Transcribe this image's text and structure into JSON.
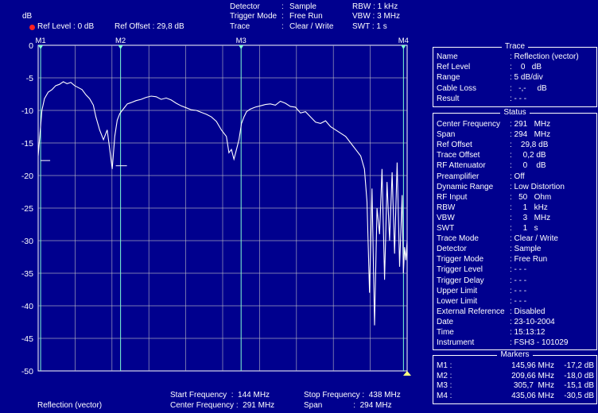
{
  "header": {
    "detector_label": "Detector",
    "detector_sep": ":",
    "detector_value": "Sample",
    "trigger_label": "Trigger Mode",
    "trigger_sep": ":",
    "trigger_value": "Free Run",
    "trace_label": "Trace",
    "trace_sep": ":",
    "trace_value": "Clear / Write",
    "rbw": "RBW : 1 kHz",
    "vbw": "VBW : 3 MHz",
    "swt": "SWT : 1 s",
    "unit": "dB",
    "ref_level": "Ref Level : 0 dB",
    "ref_offset": "Ref Offset : 29,8 dB"
  },
  "colors": {
    "background": "#00008e",
    "grid": "#c8c8c8",
    "trace": "#ffffff",
    "marker_line": "#7fffd4",
    "ref_dot": "#ff2020",
    "end_marker": "#ffff80"
  },
  "chart_data": {
    "type": "line",
    "ylim": [
      -50,
      0
    ],
    "yticks": [
      "0",
      "-5",
      "-10",
      "-15",
      "-20",
      "-25",
      "-30",
      "-35",
      "-40",
      "-45",
      "-50"
    ],
    "xlim": [
      144,
      438
    ],
    "x_unit": "MHz",
    "y_unit": "dB",
    "grid": true,
    "markers": [
      {
        "label": "M1",
        "x": 145.96,
        "y": -17.2
      },
      {
        "label": "M2",
        "x": 209.66,
        "y": -18.0
      },
      {
        "label": "M3",
        "x": 305.7,
        "y": -15.1
      },
      {
        "label": "M4",
        "x": 435.06,
        "y": -30.5
      }
    ],
    "series": [
      {
        "x": [
          144,
          147,
          149,
          152,
          155,
          158,
          161,
          164,
          167,
          170,
          173,
          176,
          179,
          182,
          185,
          188,
          190,
          193,
          196,
          199,
          201,
          203,
          205,
          207,
          209,
          211,
          213,
          215,
          218,
          222,
          226,
          230,
          234,
          238,
          242,
          246,
          250,
          254,
          258,
          262,
          266,
          270,
          274,
          278,
          282,
          286,
          290,
          294,
          296,
          298,
          300,
          302,
          304,
          306,
          308,
          310,
          313,
          317,
          321,
          325,
          329,
          333,
          337,
          341,
          345,
          349,
          353,
          357,
          361,
          365,
          369,
          373,
          377,
          381,
          385,
          389,
          393,
          397,
          401,
          404,
          406,
          408,
          410,
          412,
          414,
          416,
          418,
          420,
          422,
          424,
          426,
          428,
          430,
          432,
          434,
          435,
          436,
          437,
          438
        ],
        "y": [
          -17,
          -10,
          -8.2,
          -7.2,
          -6.8,
          -6.2,
          -6.0,
          -5.6,
          -5.9,
          -5.7,
          -6.2,
          -6.5,
          -6.8,
          -7.6,
          -8.2,
          -9.2,
          -11,
          -13,
          -14.5,
          -13,
          -16,
          -19,
          -14,
          -11.5,
          -10.5,
          -10,
          -9.5,
          -9,
          -8.8,
          -8.5,
          -8.3,
          -8.0,
          -7.8,
          -7.9,
          -8.3,
          -8.1,
          -8.4,
          -8.9,
          -9.3,
          -9.6,
          -9.9,
          -10,
          -10.3,
          -10.6,
          -11,
          -11.7,
          -13,
          -14,
          -16.5,
          -16,
          -17.5,
          -16,
          -14.5,
          -12,
          -11,
          -10.2,
          -9.8,
          -9.5,
          -9.3,
          -9.1,
          -9.0,
          -9.2,
          -8.6,
          -8.9,
          -9.4,
          -9.5,
          -10.4,
          -10.2,
          -11,
          -11.8,
          -12,
          -11.6,
          -12.5,
          -13,
          -13.5,
          -14,
          -15,
          -16,
          -17,
          -19,
          -24,
          -38,
          -22,
          -43,
          -25,
          -29,
          -19,
          -36,
          -21,
          -30,
          -19.5,
          -32,
          -18,
          -34,
          -23,
          -35,
          -31,
          -33,
          -30
        ]
      }
    ]
  },
  "footer": {
    "trace_name": "Reflection (vector)",
    "start_freq": "Start Frequency  :  144 MHz",
    "center_freq": "Center Frequency :  291 MHz",
    "stop_freq": "Stop Frequency :  438 MHz",
    "span": "Span              :  294 MHz"
  },
  "trace_panel": {
    "title": "Trace",
    "rows": [
      {
        "k": "Name",
        "v": ": Reflection (vector)"
      },
      {
        "k": "Ref Level",
        "v": ":    0   dB"
      },
      {
        "k": "Range",
        "v": ": 5 dB/div"
      },
      {
        "k": "Cable Loss",
        "v": ":   -,-     dB"
      },
      {
        "k": "Result",
        "v": ": - - -"
      }
    ]
  },
  "status_panel": {
    "title": "Status",
    "rows": [
      {
        "k": "Center Frequency",
        "v": ": 291   MHz"
      },
      {
        "k": "Span",
        "v": ": 294   MHz"
      },
      {
        "k": "Ref Offset",
        "v": ":    29,8 dB"
      },
      {
        "k": "Trace Offset",
        "v": ":     0,2 dB"
      },
      {
        "k": "RF Attenuator",
        "v": ":     0    dB"
      },
      {
        "k": "Preamplifier",
        "v": ": Off"
      },
      {
        "k": "Dynamic Range",
        "v": ": Low Distortion"
      },
      {
        "k": "RF Input",
        "v": ":   50   Ohm"
      },
      {
        "k": "RBW",
        "v": ":     1   kHz"
      },
      {
        "k": "VBW",
        "v": ":     3   MHz"
      },
      {
        "k": "SWT",
        "v": ":     1   s"
      },
      {
        "k": "Trace Mode",
        "v": ": Clear / Write"
      },
      {
        "k": "Detector",
        "v": ": Sample"
      },
      {
        "k": "Trigger Mode",
        "v": ": Free Run"
      },
      {
        "k": "Trigger Level",
        "v": ": - - -"
      },
      {
        "k": "Trigger Delay",
        "v": ": - - -"
      },
      {
        "k": "Upper Limit",
        "v": ": - - -"
      },
      {
        "k": "Lower Limit",
        "v": ": - - -"
      },
      {
        "k": "External Reference",
        "v": ": Disabled"
      },
      {
        "k": "Date",
        "v": ": 23-10-2004"
      },
      {
        "k": "Time",
        "v": ": 15:13:12"
      },
      {
        "k": "Instrument",
        "v": ": FSH3 - 101029"
      }
    ]
  },
  "markers_panel": {
    "title": "Markers",
    "rows": [
      {
        "label": "M1 :",
        "freq": "145,96 MHz",
        "level": "-17,2 dB"
      },
      {
        "label": "M2 :",
        "freq": "209,66 MHz",
        "level": "-18,0 dB"
      },
      {
        "label": "M3 :",
        "freq": "305,7  MHz",
        "level": "-15,1 dB"
      },
      {
        "label": "M4 :",
        "freq": "435,06 MHz",
        "level": "-30,5 dB"
      }
    ]
  }
}
